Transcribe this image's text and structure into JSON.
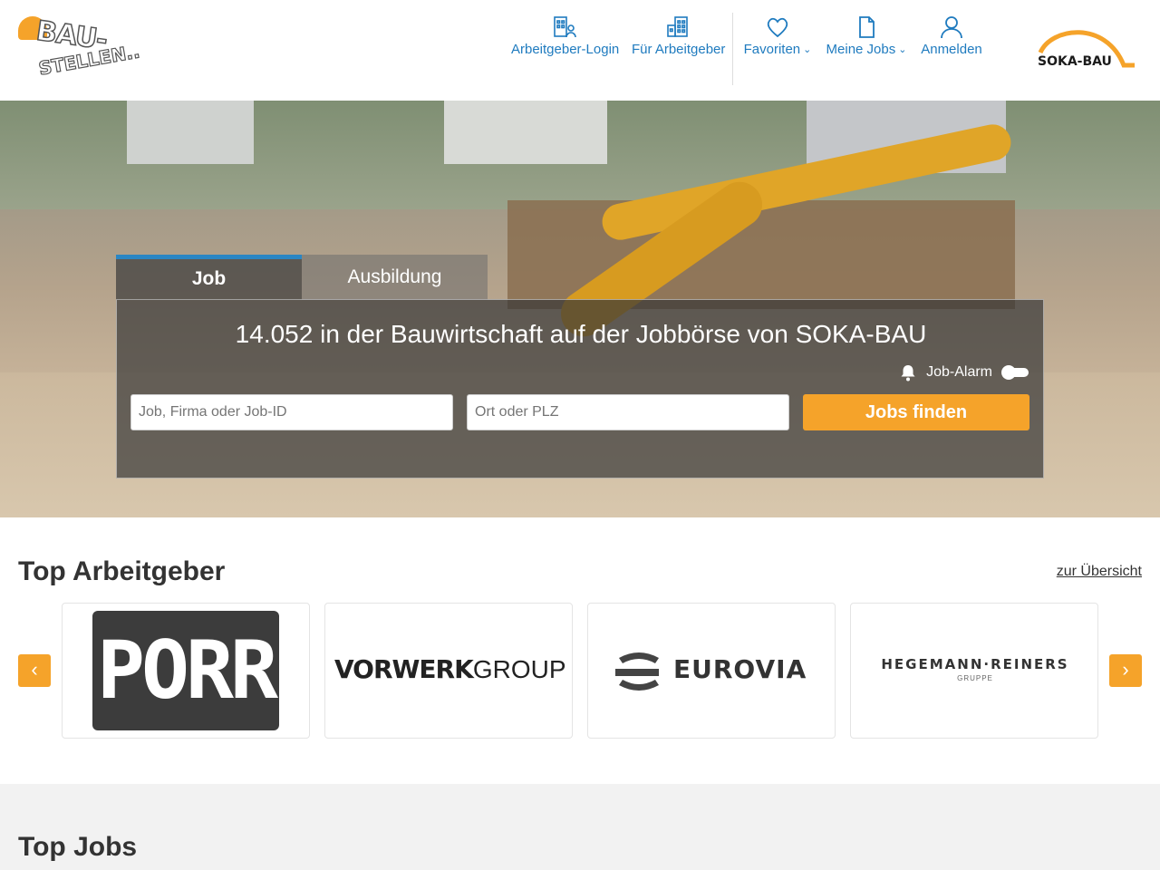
{
  "logo": {
    "line1": "BAU-",
    "line2": "STELLEN.."
  },
  "nav": {
    "employer_login": "Arbeitgeber-Login",
    "for_employers": "Für Arbeitgeber",
    "favorites": "Favoriten",
    "my_jobs": "Meine Jobs",
    "login": "Anmelden",
    "chevron": "⌄"
  },
  "partner_logo": {
    "text": "SOKA-BAU"
  },
  "search": {
    "tabs": [
      {
        "label": "Job",
        "active": true
      },
      {
        "label": "Ausbildung",
        "active": false
      }
    ],
    "headline": "14.052 in der Bauwirtschaft auf der Jobbörse von SOKA-BAU",
    "job_alarm_label": "Job-Alarm",
    "job_alarm_enabled": false,
    "query_placeholder": "Job, Firma oder Job-ID",
    "location_placeholder": "Ort oder PLZ",
    "submit_label": "Jobs finden"
  },
  "top_employers": {
    "title": "Top Arbeitgeber",
    "overview_link": "zur Übersicht",
    "prev_arrow": "‹",
    "next_arrow": "›",
    "employers": [
      {
        "logo_text": "PORR"
      },
      {
        "logo_bold": "VORWERK",
        "logo_light": "GROUP"
      },
      {
        "logo_text": "EUROVIA"
      },
      {
        "logo_text": "HEGEMANN·REINERS",
        "logo_sub": "GRUPPE"
      }
    ]
  },
  "top_jobs": {
    "title": "Top Jobs"
  },
  "colors": {
    "accent": "#f5a32a",
    "link_blue": "#1f7bbf",
    "tab_active_border": "#2a86c4"
  }
}
